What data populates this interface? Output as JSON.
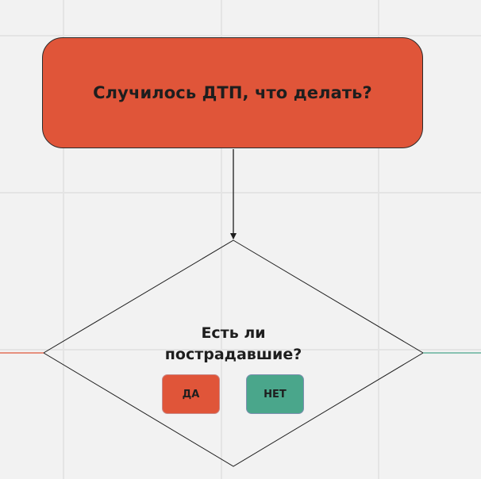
{
  "start_node": {
    "label": "Случилось ДТП, что делать?"
  },
  "decision_node": {
    "question_line_1": "Есть ли",
    "question_line_2": "пострадавшие?"
  },
  "answers": {
    "yes_label": "ДА",
    "no_label": "НЕТ"
  },
  "colors": {
    "start_fill": "#e05539",
    "yes_fill": "#e05539",
    "no_fill": "#4aa68b",
    "yes_connector": "#e05539",
    "no_connector": "#4aa68b",
    "canvas_background": "#f2f2f2"
  }
}
